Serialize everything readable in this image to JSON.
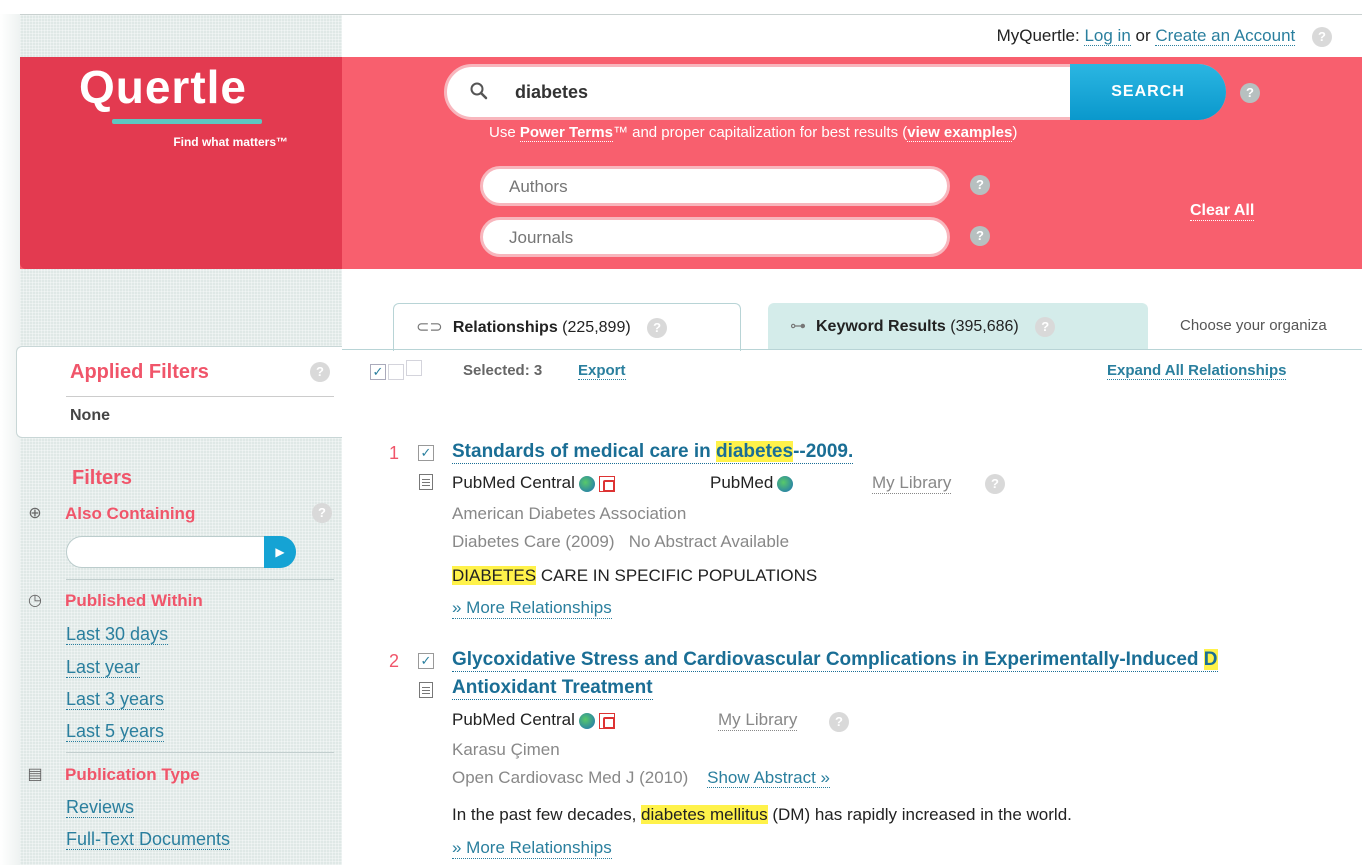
{
  "topbar": {
    "prefix": "MyQuertle:",
    "login": "Log in",
    "or": "or",
    "create": "Create an Account",
    "help": "?"
  },
  "logo": {
    "name": "Quertle",
    "tagline": "Find what matters™"
  },
  "search": {
    "query": "diabetes",
    "button": "SEARCH",
    "help": "?",
    "tip_pre": "Use ",
    "tip_power": "Power Terms",
    "tip_mid": "™ and proper capitalization for best results (",
    "tip_examples": "view examples",
    "tip_end": ")",
    "authors_placeholder": "Authors",
    "journals_placeholder": "Journals",
    "clear_all": "Clear All"
  },
  "tabs": {
    "relationships_label": "Relationships",
    "relationships_count": "(225,899)",
    "keyword_label": "Keyword Results",
    "keyword_count": "(395,686)",
    "org_text": "Choose your organiza",
    "help": "?"
  },
  "selection": {
    "text": "Selected: 3",
    "export": "Export",
    "expand_all": "Expand All Relationships"
  },
  "sidebar": {
    "applied_title": "Applied Filters",
    "applied_value": "None",
    "filters_title": "Filters",
    "also_containing": "Also Containing",
    "published_within": "Published Within",
    "published_links": [
      "Last 30 days",
      "Last year",
      "Last 3 years",
      "Last 5 years"
    ],
    "publication_type": "Publication Type",
    "pubtype_links": [
      "Reviews",
      "Full-Text Documents"
    ],
    "help": "?"
  },
  "results": [
    {
      "num": "1",
      "title_pre": "Standards of medical care in ",
      "title_hl": "diabetes",
      "title_post": "--2009.",
      "source1": "PubMed Central",
      "source2": "PubMed",
      "library": "My Library",
      "author": "American Diabetes Association",
      "journal": "Diabetes Care (2009)",
      "abstract": "No Abstract Available",
      "snippet_hl": "DIABETES",
      "snippet_post": " CARE IN SPECIFIC POPULATIONS",
      "more": "» More Relationships"
    },
    {
      "num": "2",
      "title_line1": "Glycoxidative Stress and Cardiovascular Complications in Experimentally-Induced ",
      "title_line1_hl": "D",
      "title_line2": "Antioxidant Treatment",
      "source1": "PubMed Central",
      "library": "My Library",
      "author": "Karasu Çimen",
      "journal": "Open Cardiovasc Med J (2010)",
      "abstract": "Show Abstract »",
      "snippet_pre": "In the past few decades, ",
      "snippet_hl": "diabetes mellitus",
      "snippet_post": " (DM) has rapidly increased in the world.",
      "more": "» More Relationships"
    }
  ],
  "colors": {
    "accent": "#f85f6e",
    "logo_bg": "#e33a50",
    "link": "#2a7f9e",
    "button": "#0a98cc",
    "highlight": "#fff24a"
  }
}
